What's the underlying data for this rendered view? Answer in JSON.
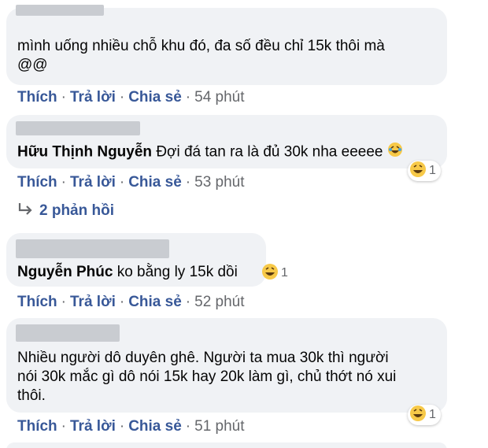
{
  "colors": {
    "bubble": "#f0f2f5",
    "link": "#385898",
    "muted": "#65676b",
    "text": "#050505"
  },
  "actions": {
    "like": "Thích",
    "reply": "Trả lời",
    "share": "Chia sẻ",
    "separator": "·"
  },
  "comments": [
    {
      "author": "",
      "text_line1": "mình uống nhiều chỗ khu đó, đa số đều chỉ 15k thôi mà",
      "text_line2": "@@",
      "time": "54 phút"
    },
    {
      "author": "Hữu Thịnh Nguyễn",
      "text": "Đợi đá tan ra là đủ 30k nha eeeee",
      "reaction_icon": "haha-emoji-icon",
      "reaction_count": "1",
      "time": "53 phút",
      "replies_label": "2 phản hồi"
    },
    {
      "author": "Nguyễn Phúc",
      "text": "ko bằng ly 15k dồi",
      "reaction_icon": "haha-emoji-icon",
      "reaction_count": "1",
      "time": "52 phút"
    },
    {
      "author": "",
      "text_line1": "Nhiều người dô duyên ghê. Người ta mua 30k thì người",
      "text_line2": "nói 30k mắc gì dô nói 15k hay 20k làm gì, chủ thớt nó xui",
      "text_line3": "thôi.",
      "reaction_icon": "haha-emoji-icon",
      "reaction_count": "1",
      "time": "51 phút"
    }
  ]
}
